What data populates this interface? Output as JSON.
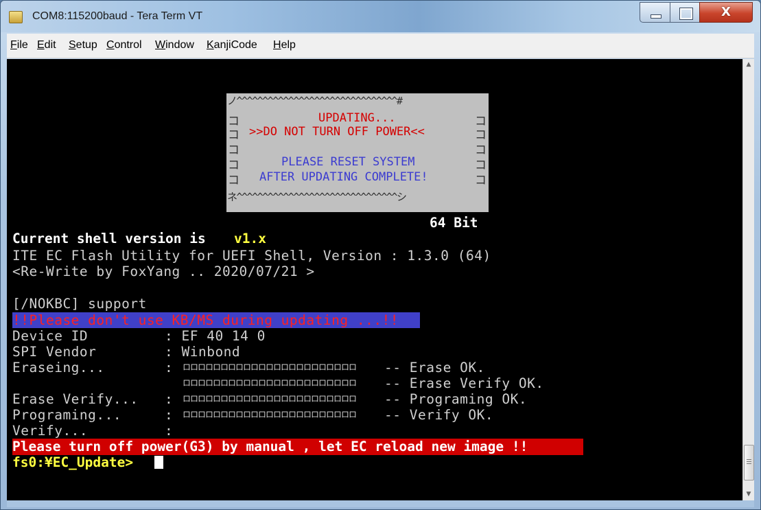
{
  "window": {
    "title": "COM8:115200baud - Tera Term VT",
    "close_glyph": "X"
  },
  "menu": [
    "File",
    "Edit",
    "Setup",
    "Control",
    "Window",
    "KanjiCode",
    "Help"
  ],
  "dialog": {
    "top_border": "ノ^^^^^^^^^^^^^^^^^^^^^^^^^^^^^^^#",
    "line1": "UPDATING...",
    "line2": ">>DO NOT TURN OFF POWER<<",
    "line3": "PLEASE RESET SYSTEM",
    "line4": "AFTER UPDATING COMPLETE!",
    "bottom_border": "ネ^^^^^^^^^^^^^^^^^^^^^^^^^^^^^^^シ",
    "side_glyph": "コ"
  },
  "terminal": {
    "bit_label": "64 Bit",
    "shell_version_prefix": "Current shell version is ",
    "shell_version": "v1.x",
    "utility_line": "ITE EC Flash Utility for UEFI Shell, Version : 1.3.0 (64)",
    "rewrite_line": "<Re-Write by FoxYang .. 2020/07/21 >",
    "nokbc_line": "[/NOKBC] support",
    "warning_kbms": "!!Please don't use KB/MS during updating ...!!",
    "device_id_label": "Device ID",
    "device_id_value": ": EF 40 14 0",
    "spi_vendor_label": "SPI Vendor",
    "spi_vendor_value": ": Winbond",
    "erasing_label": "Eraseing...",
    "progress_bar": "ロロロロロロロロロロロロロロロロロロロロロロロ",
    "colon": ":",
    "erase_ok": "-- Erase OK.",
    "erase_verify_ok": "-- Erase Verify OK.",
    "erase_verify_label": "Erase Verify...",
    "programming_label": "Programing...",
    "programming_ok": "-- Programing OK.",
    "verify_ok": "-- Verify OK.",
    "verify_label": "Verify...",
    "power_off_msg": "Please turn off power(G3) by manual , let EC reload new image !!",
    "prompt": "fs0:¥EC_Update>"
  },
  "colors": {
    "terminal_bg": "#000000",
    "dialog_bg": "#c0c0c0",
    "warning_red_text": "#ff2020",
    "warning_blue_bg": "#4040c8",
    "power_red_bg": "#d00000",
    "highlight_yellow": "#ffff40"
  }
}
